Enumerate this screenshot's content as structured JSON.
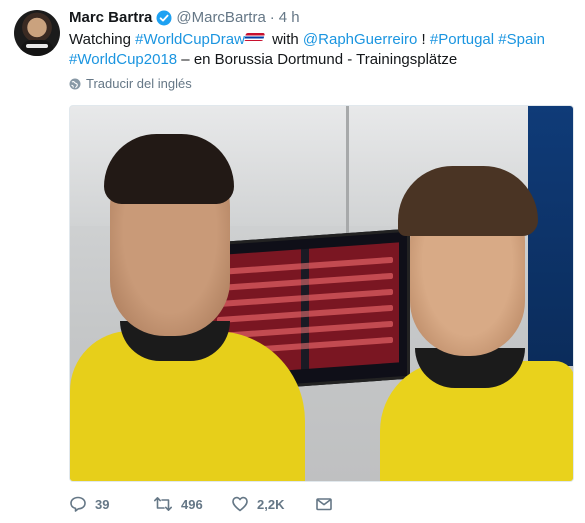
{
  "tweet": {
    "author_name": "Marc Bartra",
    "handle": "@MarcBartra",
    "separator": "·",
    "time": "4 h",
    "text": {
      "t1": "Watching ",
      "hashtag_draw": "#WorldCupDraw",
      "t2": " with ",
      "mention": "@RaphGuerreiro",
      "t3": " ! ",
      "hashtag_portugal": "#Portugal",
      "t4": " ",
      "hashtag_spain": "#Spain",
      "t5": " ",
      "hashtag_wc2018": "#WorldCup2018",
      "t6": " – en Borussia Dortmund - Trainingsplätze"
    },
    "translate_label": "Traducir del inglés",
    "actions": {
      "replies": "39",
      "retweets": "496",
      "likes": "2,2K"
    }
  },
  "colors": {
    "link": "#1b95e0",
    "secondary_text": "#657786",
    "verified": "#1da1f2"
  },
  "icons": {
    "verified": "verified-badge-icon",
    "globe": "globe-icon",
    "reply": "reply-icon",
    "retweet": "retweet-icon",
    "like": "heart-icon",
    "message": "envelope-icon"
  }
}
